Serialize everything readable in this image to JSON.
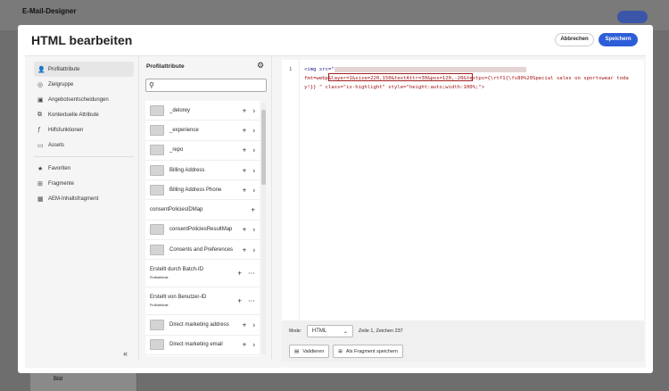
{
  "background": {
    "app_title": "E-Mail-Designer",
    "bottom_item": "Bild"
  },
  "dialog": {
    "title": "HTML bearbeiten",
    "cancel": "Abbrechen",
    "save": "Speichern"
  },
  "nav": {
    "items": [
      {
        "label": "Profilattribute",
        "icon": "person-icon",
        "active": true
      },
      {
        "label": "Zielgruppe",
        "icon": "audience-icon"
      },
      {
        "label": "Angebotsentscheidungen",
        "icon": "offer-icon"
      },
      {
        "label": "Kontextuelle Attribute",
        "icon": "context-icon"
      },
      {
        "label": "Hilfsfunktionen",
        "icon": "function-icon"
      },
      {
        "label": "Assets",
        "icon": "image-icon"
      }
    ],
    "items2": [
      {
        "label": "Favoriten",
        "icon": "star-icon"
      },
      {
        "label": "Fragmente",
        "icon": "fragment-icon"
      },
      {
        "label": "AEM-Inhaltsfragment",
        "icon": "aem-icon"
      }
    ]
  },
  "panel": {
    "title": "Profilattribute",
    "search_placeholder": "",
    "rows": [
      {
        "label": "_delorey",
        "folder": true
      },
      {
        "label": "_experience",
        "folder": true
      },
      {
        "label": "_repo",
        "folder": true
      },
      {
        "label": "Billing Address",
        "folder": true
      },
      {
        "label": "Billing Address Phone",
        "folder": true
      },
      {
        "label": "consentPoliciesIDMap",
        "folder": false
      },
      {
        "label": "consentPoliciesResultMap",
        "folder": true
      },
      {
        "label": "Consents and Preferences",
        "folder": true
      },
      {
        "label": "Erstellt durch Batch-ID",
        "sub": "Profilattribute",
        "tall": true
      },
      {
        "label": "Erstellt von Benutzer-ID",
        "sub": "Profilattribute",
        "tall": true
      },
      {
        "label": "Direct marketing address",
        "folder": true
      },
      {
        "label": "Direct marketing email",
        "folder": true
      }
    ]
  },
  "editor": {
    "line_number": "1",
    "code_start": "<img src=\"",
    "code_rest": "fmt=webp&layer=1&size=220,150&textAttr=30&pos=120,-20&textps={\\rtf1{\\fs80%20Special sales on sportswear today!}} \" class=\"is-highlight\" style=\"height:auto;width:100%;\">",
    "mode_label": "Mode:",
    "mode_value": "HTML",
    "cursor_pos": "Zeile 1, Zeichen 237",
    "validate": "Validieren",
    "save_fragment": "Als Fragment speichern"
  },
  "colors": {
    "primary": "#2d5ed8",
    "highlight_box": "#a02020"
  }
}
